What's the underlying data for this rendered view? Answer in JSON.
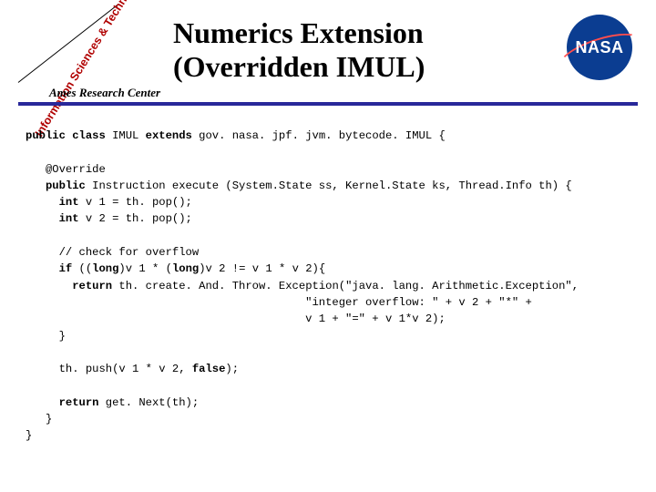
{
  "header": {
    "title_line1": "Numerics Extension",
    "title_line2": "(Overridden IMUL)"
  },
  "badge": {
    "diagonal": "Information Sciences & Technology",
    "center": "Ames Research Center"
  },
  "nasa": {
    "text": "NASA"
  },
  "code": {
    "l1a": "public class ",
    "l1b": "IMUL ",
    "l1c": "extends ",
    "l1d": "gov. nasa. jpf. jvm. bytecode. IMUL {",
    "l2": "   @Override",
    "l3a": "   public ",
    "l3b": "Instruction execute (System.State ss, Kernel.State ks, Thread.Info th) {",
    "l4a": "     int ",
    "l4b": "v 1 = th. pop();",
    "l5a": "     int ",
    "l5b": "v 2 = th. pop();",
    "l6": "     // check for overflow",
    "l7a": "     if ",
    "l7b": "((",
    "l7c": "long",
    "l7d": ")v 1 * (",
    "l7e": "long",
    "l7f": ")v 2 != v 1 * v 2){",
    "l8a": "       return ",
    "l8b": "th. create. And. Throw. Exception(\"java. lang. Arithmetic.Exception\",",
    "l9": "                                          \"integer overflow: \" + v 2 + \"*\" +",
    "l10": "                                          v 1 + \"=\" + v 1*v 2);",
    "l11": "     }",
    "l12a": "     th. push(v 1 * v 2, ",
    "l12b": "false",
    "l12c": ");",
    "l13a": "     return ",
    "l13b": "get. Next(th);",
    "l14": "   }",
    "l15": "}"
  }
}
